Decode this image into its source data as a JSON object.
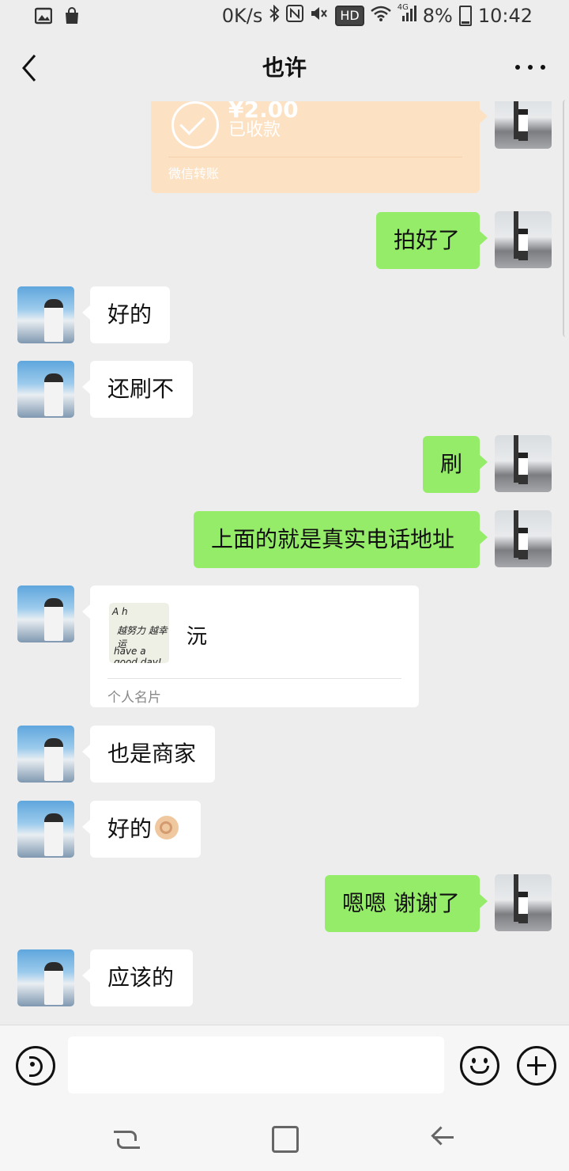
{
  "status_bar": {
    "speed": "0K/s",
    "network": "4G",
    "battery": "8%",
    "time": "10:42",
    "hd": "HD",
    "icons": [
      "gallery-icon",
      "shopping-bag-icon",
      "bluetooth-icon",
      "nfc-icon",
      "mute-icon",
      "wifi-icon",
      "signal-icon",
      "battery-icon"
    ]
  },
  "header": {
    "title": "也许",
    "back_icon": "chevron-left-icon",
    "more_icon": "more-dots-icon"
  },
  "messages": [
    {
      "side": "out",
      "type": "transfer",
      "amount": "¥2.00",
      "status": "已收款",
      "label": "微信转账"
    },
    {
      "side": "out",
      "type": "text",
      "text": "拍好了"
    },
    {
      "side": "in",
      "type": "text",
      "text": "好的"
    },
    {
      "side": "in",
      "type": "text",
      "text": "还刷不"
    },
    {
      "side": "out",
      "type": "text",
      "text": "刷"
    },
    {
      "side": "out",
      "type": "text",
      "text": "上面的就是真实电话地址"
    },
    {
      "side": "in",
      "type": "contact_card",
      "name": "沅",
      "label": "个人名片"
    },
    {
      "side": "in",
      "type": "text",
      "text": "也是商家"
    },
    {
      "side": "in",
      "type": "text",
      "text": "好的",
      "emoji": "ok-hand-emoji"
    },
    {
      "side": "out",
      "type": "text",
      "text": "嗯嗯 谢谢了"
    },
    {
      "side": "in",
      "type": "text",
      "text": "应该的"
    }
  ],
  "input_bar": {
    "value": "",
    "placeholder": "",
    "icons": [
      "voice-icon",
      "emoji-icon",
      "plus-icon"
    ]
  },
  "nav_bar": {
    "icons": [
      "recent-apps-icon",
      "home-icon",
      "back-icon"
    ]
  },
  "colors": {
    "background": "#ededed",
    "outgoing_bubble": "#95ec69",
    "incoming_bubble": "#ffffff",
    "transfer_card": "#fde1c3"
  }
}
